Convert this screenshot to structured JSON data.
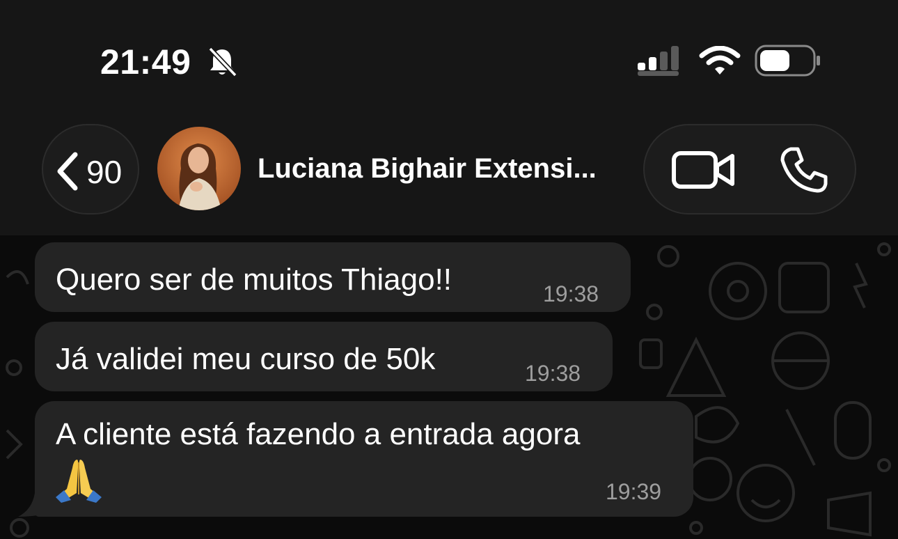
{
  "status_bar": {
    "time": "21:49",
    "icons": [
      "bell-off-icon",
      "signal-icon",
      "wifi-icon",
      "battery-icon"
    ]
  },
  "header": {
    "back_count": "90",
    "contact_name": "Luciana Bighair Extensi...",
    "actions": [
      "video-call-icon",
      "phone-icon"
    ]
  },
  "messages": [
    {
      "text": "Quero ser de muitos Thiago!!",
      "time": "19:38"
    },
    {
      "text": "Já validei meu curso de 50k",
      "time": "19:38"
    },
    {
      "text": "A cliente está fazendo a entrada agora",
      "emoji": "🙏",
      "time": "19:39"
    }
  ],
  "colors": {
    "header_bg": "#161616",
    "chat_bg": "#0b0b0b",
    "bubble_bg": "#242424",
    "timestamp": "#9e9e9e"
  }
}
